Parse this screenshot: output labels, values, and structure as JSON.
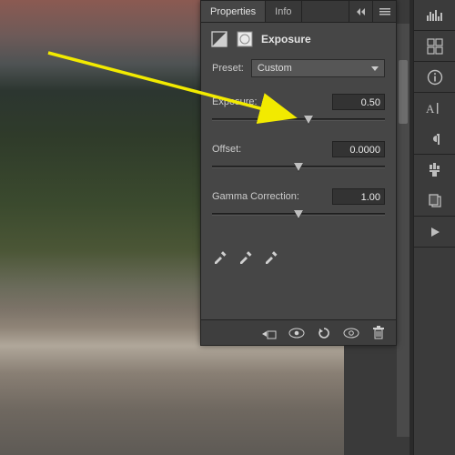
{
  "panel": {
    "tabs": {
      "properties": "Properties",
      "info": "Info"
    },
    "title": "Exposure",
    "preset": {
      "label": "Preset:",
      "value": "Custom"
    },
    "exposure": {
      "label": "Exposure:",
      "value": "0.50",
      "slider_percent": 56
    },
    "offset": {
      "label": "Offset:",
      "value": "0.0000",
      "slider_percent": 50
    },
    "gamma": {
      "label": "Gamma Correction:",
      "value": "1.00",
      "slider_percent": 50
    }
  },
  "colors": {
    "annotation": "#f2ea00"
  }
}
